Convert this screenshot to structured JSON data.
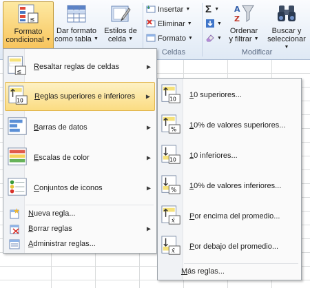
{
  "ribbon": {
    "formato_condicional": {
      "line1": "Formato",
      "line2": "condicional",
      "icon": "conditional-format-icon"
    },
    "dar_formato_tabla": {
      "line1": "Dar formato",
      "line2": "como tabla",
      "icon": "table-format-icon"
    },
    "estilos_celda": {
      "line1": "Estilos de",
      "line2": "celda",
      "icon": "cell-styles-icon"
    },
    "celdas": {
      "insertar": "Insertar",
      "eliminar": "Eliminar",
      "formato": "Formato",
      "group_label": "Celdas"
    },
    "modificar": {
      "sum_symbol": "Σ",
      "ordenar_line1": "Ordenar",
      "ordenar_line2": "y filtrar",
      "buscar_line1": "Buscar y",
      "buscar_line2": "seleccionar",
      "group_label": "Modificar"
    }
  },
  "menu": {
    "items": [
      {
        "label": "Resaltar reglas de celdas",
        "mnemonic": "R",
        "rest": "esaltar reglas de celdas",
        "icon": "highlight-rules-icon",
        "has_submenu": true
      },
      {
        "label": "Reglas superiores e inferiores",
        "mnemonic": "R",
        "rest": "eglas superiores e inferiores",
        "icon": "top-bottom-rules-icon",
        "has_submenu": true,
        "highlighted": true
      },
      {
        "label": "Barras de datos",
        "mnemonic": "B",
        "rest": "arras de datos",
        "icon": "data-bars-icon",
        "has_submenu": true
      },
      {
        "label": "Escalas de color",
        "mnemonic": "E",
        "rest": "scalas de color",
        "icon": "color-scales-icon",
        "has_submenu": true
      },
      {
        "label": "Conjuntos de iconos",
        "mnemonic": "C",
        "rest": "onjuntos de iconos",
        "icon": "icon-sets-icon",
        "has_submenu": true
      }
    ],
    "small_items": [
      {
        "label": "Nueva regla...",
        "mnemonic": "N",
        "rest": "ueva regla...",
        "icon": "new-rule-icon",
        "has_submenu": false
      },
      {
        "label": "Borrar reglas",
        "mnemonic": "B",
        "rest": "orrar reglas",
        "icon": "clear-rules-icon",
        "has_submenu": true
      },
      {
        "label": "Administrar reglas...",
        "mnemonic": "A",
        "rest": "dministrar reglas...",
        "icon": "manage-rules-icon",
        "has_submenu": false
      }
    ]
  },
  "submenu": {
    "items": [
      {
        "label": "10 superiores...",
        "mnemonic": "1",
        "rest": "0 superiores...",
        "badge": "10",
        "direction": "up"
      },
      {
        "label": "10% de valores superiores...",
        "mnemonic": "1",
        "rest": "0% de valores superiores...",
        "badge": "%",
        "direction": "up"
      },
      {
        "label": "10 inferiores...",
        "mnemonic": "1",
        "rest": "0 inferiores...",
        "badge": "10",
        "direction": "down"
      },
      {
        "label": "10% de valores inferiores...",
        "mnemonic": "1",
        "rest": "0% de valores inferiores...",
        "badge": "%",
        "direction": "down"
      },
      {
        "label": "Por encima del promedio...",
        "mnemonic": "P",
        "rest": "or encima del promedio...",
        "badge": "x̄",
        "direction": "up"
      },
      {
        "label": "Por debajo del promedio...",
        "mnemonic": "P",
        "rest": "or debajo del promedio...",
        "badge": "x̄",
        "direction": "down"
      }
    ],
    "more_rules": {
      "label": "Más reglas...",
      "mnemonic": "M",
      "rest": "ás reglas..."
    }
  },
  "colors": {
    "highlight": "#fbdc82",
    "menu_bg": "#fafafa",
    "ribbon_bg": "#dfe9f5"
  }
}
